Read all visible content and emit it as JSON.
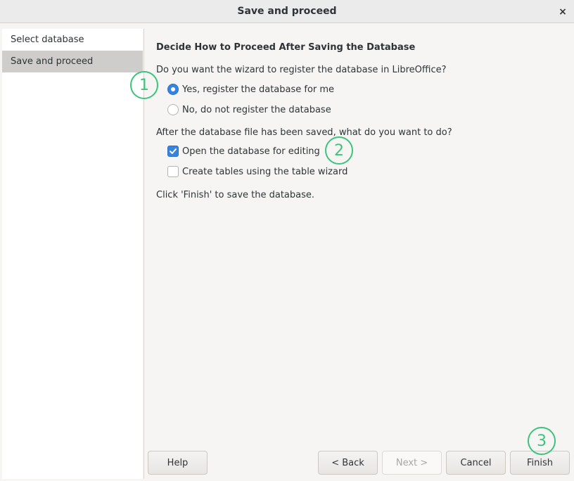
{
  "window": {
    "title": "Save and proceed",
    "close_glyph": "×"
  },
  "sidebar": {
    "items": [
      {
        "label": "Select database"
      },
      {
        "label": "Save and proceed"
      }
    ]
  },
  "main": {
    "heading": "Decide How to Proceed After Saving the Database",
    "register_question": "Do you want the wizard to register the database in LibreOffice?",
    "register_options": [
      {
        "label": "Yes, register the database for me",
        "selected": true
      },
      {
        "label": "No, do not register the database",
        "selected": false
      }
    ],
    "after_save_question": "After the database file has been saved, what do you want to do?",
    "after_save_options": [
      {
        "label": "Open the database for editing",
        "checked": true
      },
      {
        "label": "Create tables using the table wizard",
        "checked": false
      }
    ],
    "finish_hint": "Click 'Finish' to save the database."
  },
  "buttons": {
    "help": "Help",
    "back": "< Back",
    "next": "Next >",
    "cancel": "Cancel",
    "finish": "Finish"
  },
  "annotations": [
    "1",
    "2",
    "3"
  ],
  "colors": {
    "accent": "#3584e4",
    "annotation": "#3cc47c"
  }
}
